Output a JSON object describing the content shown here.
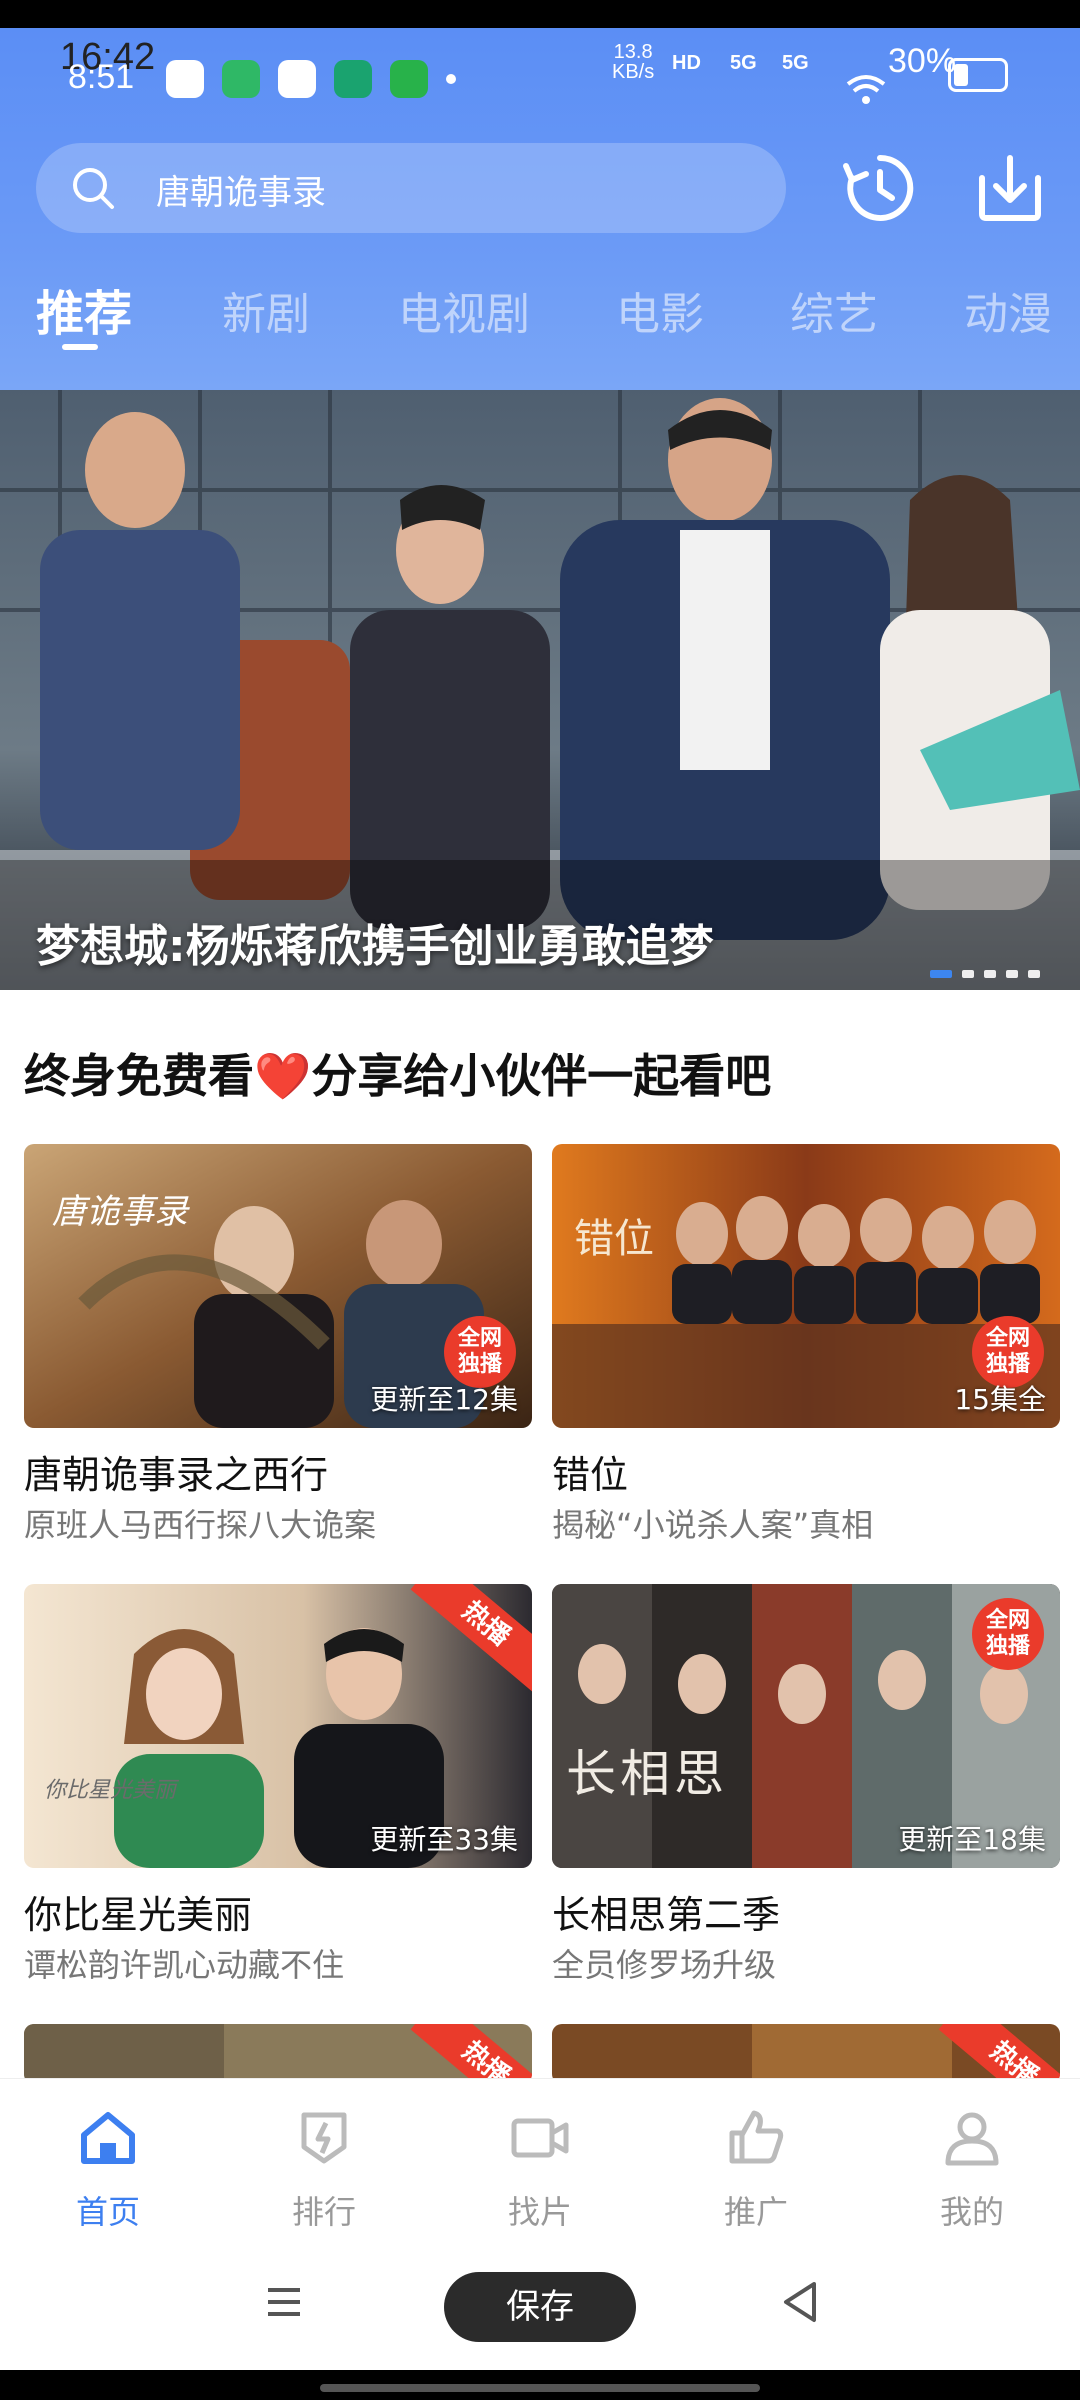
{
  "status": {
    "time_top": "16:42",
    "time_bottom": "8:51",
    "net_speed_value": "13.8",
    "net_speed_unit": "KB/s",
    "signal_1": "5G",
    "signal_2": "5G",
    "battery": "30%"
  },
  "search": {
    "placeholder": "唐朝诡事录"
  },
  "tabs": [
    "推荐",
    "新剧",
    "电视剧",
    "电影",
    "综艺",
    "动漫"
  ],
  "banner": {
    "title": "梦想城:杨烁蒋欣携手创业勇敢追梦",
    "slide_count": 5,
    "active_slide": 1
  },
  "share": {
    "text_before": "终身免费看",
    "heart": "❤️",
    "text_after": "分享给小伙伴一起看吧"
  },
  "cards": [
    {
      "title": "唐朝诡事录之西行",
      "subtitle": "原班人马西行探八大诡案",
      "episodes": "更新至12集",
      "badge": "全网\n独播",
      "thumb_text": "唐诡事录"
    },
    {
      "title": "错位",
      "subtitle": "揭秘“小说杀人案”真相",
      "episodes": "15集全",
      "badge": "全网\n独播",
      "thumb_text": "错位"
    },
    {
      "title": "你比星光美丽",
      "subtitle": "谭松韵许凯心动藏不住",
      "episodes": "更新至33集",
      "badge": "热播",
      "thumb_text": "你比星光美丽"
    },
    {
      "title": "长相思第二季",
      "subtitle": "全员修罗场升级",
      "episodes": "更新至18集",
      "badge": "全网\n独播",
      "thumb_text": "长相思"
    },
    {
      "badge": "热播"
    },
    {
      "badge": "热播"
    }
  ],
  "bottom_nav": [
    "首页",
    "排行",
    "找片",
    "推广",
    "我的"
  ],
  "system_nav": {
    "save_label": "保存"
  },
  "colors": {
    "accent": "#3d7ff0",
    "header": "#5b8ef5",
    "badge_red": "#ea3b2b"
  }
}
